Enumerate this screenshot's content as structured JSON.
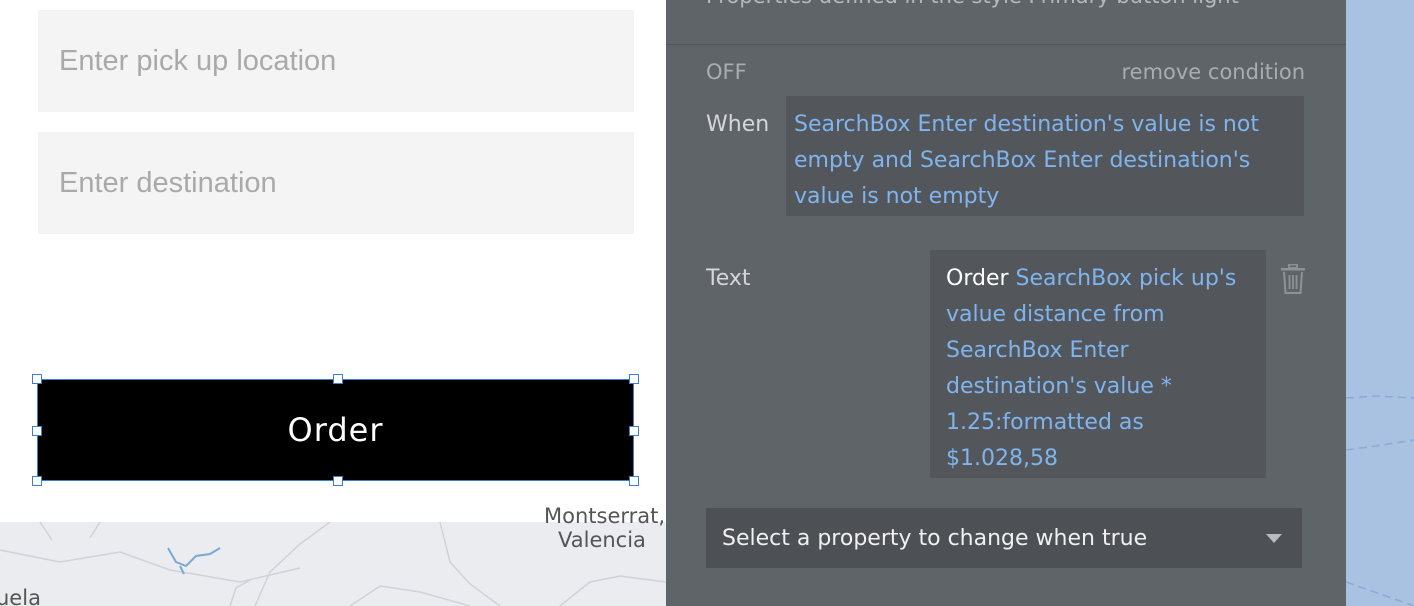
{
  "canvas": {
    "pickup_placeholder": "Enter pick up location",
    "destination_placeholder": "Enter destination",
    "order_button_label": "Order",
    "map_labels": [
      "Montserrat,",
      "Valencia",
      "uela"
    ]
  },
  "panel": {
    "header_text": "Properties defined in the style Primary button light",
    "off_label": "OFF",
    "remove_condition": "remove condition",
    "when_label": "When",
    "when_expression": "SearchBox Enter destination's value is not empty and SearchBox Enter destination's value is not empty",
    "text_label": "Text",
    "text_value_plain": "Order ",
    "text_value_expression": "SearchBox pick up's value distance from SearchBox Enter destination's value * 1.25:formatted as $1.028,58",
    "select_placeholder": "Select a property to change when true"
  },
  "icons": {
    "delete": "trash-icon",
    "dropdown": "chevron-down-icon"
  },
  "colors": {
    "panel_bg": "#5f6468",
    "expression_blue": "#7fb4ef",
    "selection_blue": "#3b7dd8",
    "button_black": "#000000",
    "map_blue": "#a9c2e2"
  }
}
